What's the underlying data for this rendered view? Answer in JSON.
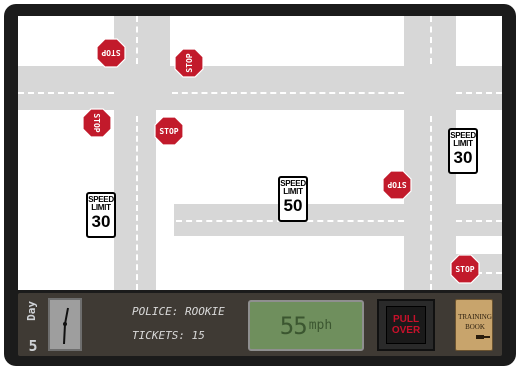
{
  "game": "traffic-cop",
  "map": {
    "stop_signs": [
      {
        "id": "stop-1",
        "label": "STOP",
        "rotation": 180
      },
      {
        "id": "stop-2",
        "label": "STOP",
        "rotation": -90
      },
      {
        "id": "stop-3",
        "label": "STOP",
        "rotation": 90
      },
      {
        "id": "stop-4",
        "label": "STOP",
        "rotation": 0
      },
      {
        "id": "stop-5",
        "label": "STOP",
        "rotation": 180
      },
      {
        "id": "stop-6",
        "label": "STOP",
        "rotation": 0
      }
    ],
    "speed_signs": [
      {
        "id": "speed-30-left",
        "top": "SPEED",
        "middle": "LIMIT",
        "value": "30"
      },
      {
        "id": "speed-50",
        "top": "SPEED",
        "middle": "LIMIT",
        "value": "50"
      },
      {
        "id": "speed-30-right",
        "top": "SPEED",
        "middle": "LIMIT",
        "value": "30"
      }
    ]
  },
  "hud": {
    "day_label": "Day",
    "day_number": "5",
    "police_label": "POLICE: ROOKIE",
    "tickets_label": "TICKETS: 15",
    "speed_value": "55",
    "speed_unit": "mph",
    "pull_over_label_1": "PULL",
    "pull_over_label_2": "OVER",
    "book_title_1": "TRAINING",
    "book_title_2": "BOOK"
  },
  "colors": {
    "frame": "#1b1b1b",
    "road": "#d7d7d7",
    "stop_red": "#c21a2b",
    "hud_bg": "#3f3a34",
    "speedometer_green": "#6f8f5d",
    "pull_over_red": "#c8112b",
    "book_tan": "#c8a46c"
  },
  "clock": {
    "hour_hand_angle_deg": 15,
    "minute_hand_angle_deg": 180
  }
}
